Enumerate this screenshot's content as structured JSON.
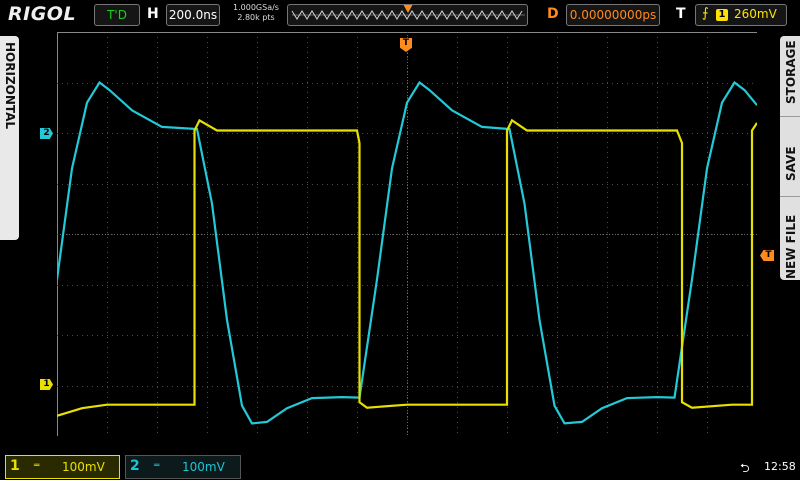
{
  "brand": "RIGOL",
  "top_bar": {
    "run_state": "T'D",
    "timebase_label": "H",
    "timebase_value": "200.0ns",
    "sample_rate": "1.000GSa/s",
    "memory_depth": "2.80k pts",
    "delay_label": "D",
    "delay_value": "0.00000000ps",
    "trigger_label": "T",
    "trigger_edge": "rising-edge-icon",
    "trigger_source": "1",
    "trigger_level": "260mV"
  },
  "side_left": {
    "label": "HORIZONTAL"
  },
  "side_right": {
    "items": [
      "STORAGE",
      "SAVE",
      "NEW FILE"
    ]
  },
  "markers": {
    "ch1": "1",
    "ch2": "2",
    "trigger_pos": "T",
    "trigger_level": "T"
  },
  "bottom_bar": {
    "channels": [
      {
        "number": "1",
        "coupling": "═",
        "scale": "100mV",
        "color": "#e8e000"
      },
      {
        "number": "2",
        "coupling": "═",
        "scale": "100mV",
        "color": "#19c6d4"
      }
    ],
    "usb_icon": "usb-icon",
    "time": "12:58"
  },
  "colors": {
    "ch1": "#e8e000",
    "ch2": "#23c9d6",
    "accent": "#ff8a1e",
    "run": "#19d219"
  },
  "chart_data": {
    "type": "line",
    "title": "",
    "xlabel": "",
    "ylabel": "",
    "x_divisions": 14,
    "y_divisions": 8,
    "x_units": "div",
    "y_units": "div",
    "xlim": [
      0,
      14
    ],
    "ylim": [
      0,
      8
    ],
    "grid": true,
    "series": [
      {
        "name": "1",
        "color": "#e8e000",
        "points": [
          [
            0,
            0.4
          ],
          [
            0.5,
            0.55
          ],
          [
            1,
            0.62
          ],
          [
            2.75,
            0.62
          ],
          [
            2.75,
            6.05
          ],
          [
            2.85,
            6.25
          ],
          [
            3.2,
            6.05
          ],
          [
            4.6,
            6.05
          ],
          [
            6.0,
            6.05
          ],
          [
            6.05,
            5.8
          ],
          [
            6.05,
            0.67
          ],
          [
            6.2,
            0.56
          ],
          [
            7,
            0.62
          ],
          [
            9.0,
            0.62
          ],
          [
            9.0,
            6.05
          ],
          [
            9.1,
            6.25
          ],
          [
            9.4,
            6.05
          ],
          [
            12.4,
            6.05
          ],
          [
            12.5,
            5.8
          ],
          [
            12.5,
            0.67
          ],
          [
            12.7,
            0.56
          ],
          [
            13.5,
            0.62
          ],
          [
            13.9,
            0.62
          ],
          [
            13.9,
            6.05
          ],
          [
            14,
            6.2
          ]
        ]
      },
      {
        "name": "2",
        "color": "#23c9d6",
        "points": [
          [
            0,
            3.1
          ],
          [
            0.3,
            5.3
          ],
          [
            0.6,
            6.6
          ],
          [
            0.85,
            7.0
          ],
          [
            1.05,
            6.85
          ],
          [
            1.5,
            6.45
          ],
          [
            2.1,
            6.12
          ],
          [
            2.8,
            6.08
          ],
          [
            3.1,
            4.6
          ],
          [
            3.4,
            2.3
          ],
          [
            3.7,
            0.6
          ],
          [
            3.9,
            0.25
          ],
          [
            4.2,
            0.28
          ],
          [
            4.6,
            0.55
          ],
          [
            5.1,
            0.75
          ],
          [
            5.7,
            0.77
          ],
          [
            6.05,
            0.76
          ],
          [
            6.4,
            3.1
          ],
          [
            6.7,
            5.3
          ],
          [
            7,
            6.6
          ],
          [
            7.25,
            7.0
          ],
          [
            7.45,
            6.85
          ],
          [
            7.9,
            6.45
          ],
          [
            8.5,
            6.12
          ],
          [
            9.05,
            6.08
          ],
          [
            9.35,
            4.6
          ],
          [
            9.65,
            2.3
          ],
          [
            9.95,
            0.6
          ],
          [
            10.15,
            0.25
          ],
          [
            10.5,
            0.28
          ],
          [
            10.9,
            0.55
          ],
          [
            11.4,
            0.75
          ],
          [
            12.0,
            0.77
          ],
          [
            12.35,
            0.76
          ],
          [
            12.7,
            3.1
          ],
          [
            13.0,
            5.3
          ],
          [
            13.3,
            6.6
          ],
          [
            13.55,
            7.0
          ],
          [
            13.75,
            6.85
          ],
          [
            14,
            6.55
          ]
        ]
      }
    ]
  }
}
